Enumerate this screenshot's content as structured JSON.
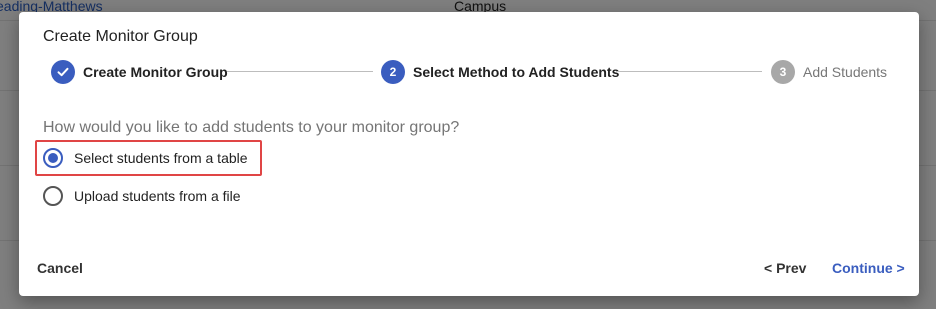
{
  "background": {
    "link_text": "eading-Matthews",
    "column_text": "Campus"
  },
  "dialog": {
    "title": "Create Monitor Group",
    "steps": [
      {
        "number": "1",
        "label": "Create Monitor Group",
        "state": "completed",
        "icon": "check-icon"
      },
      {
        "number": "2",
        "label": "Select Method to Add Students",
        "state": "active"
      },
      {
        "number": "3",
        "label": "Add Students",
        "state": "pending"
      }
    ],
    "question": "How would you like to add students to your monitor group?",
    "options": [
      {
        "label": "Select students from a table",
        "selected": true
      },
      {
        "label": "Upload students from a file",
        "selected": false
      }
    ],
    "buttons": {
      "cancel": "Cancel",
      "prev": "< Prev",
      "continue": "Continue >"
    }
  },
  "colors": {
    "accent": "#3a5dbf",
    "highlight_border": "#e04545",
    "pending_step": "#a8a8a8"
  }
}
